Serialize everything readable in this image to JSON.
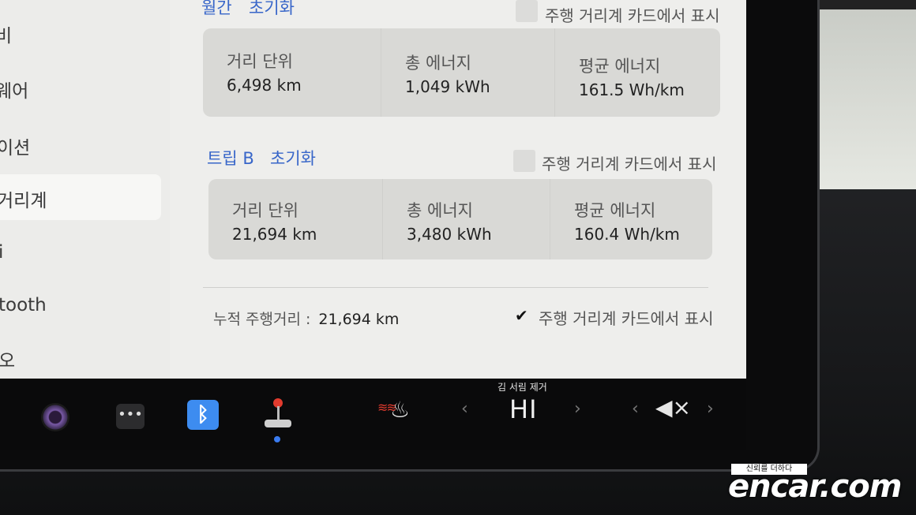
{
  "sidebar": {
    "items": [
      {
        "label": "비"
      },
      {
        "label": "웨어"
      },
      {
        "label": "이션"
      },
      {
        "label": "거리계",
        "active": true
      },
      {
        "label": "i"
      },
      {
        "label": "tooth"
      },
      {
        "label": "오"
      }
    ]
  },
  "trip_a": {
    "title": "월간",
    "reset_label": "초기화",
    "show_on_card_label": "주행 거리계 카드에서 표시",
    "show_on_card_checked": false,
    "stats": [
      {
        "label": "거리 단위",
        "value": "6,498 km"
      },
      {
        "label": "총 에너지",
        "value": "1,049 kWh"
      },
      {
        "label": "평균 에너지",
        "value": "161.5 Wh/km"
      }
    ]
  },
  "trip_b": {
    "title": "트립 B",
    "reset_label": "초기화",
    "show_on_card_label": "주행 거리계 카드에서 표시",
    "show_on_card_checked": false,
    "stats": [
      {
        "label": "거리 단위",
        "value": "21,694 km"
      },
      {
        "label": "총 에너지",
        "value": "3,480 kWh"
      },
      {
        "label": "평균 에너지",
        "value": "160.4 Wh/km"
      }
    ]
  },
  "odometer": {
    "label": "누적 주행거리 :",
    "value": "21,694 km",
    "show_on_card_label": "주행 거리계 카드에서 표시",
    "show_on_card_checked": true,
    "check_glyph": "✔"
  },
  "taskbar": {
    "dots_glyph": "•••",
    "bluetooth_glyph": "ᛒ",
    "heat_glyph": "≋≋",
    "seat_glyph": "♨",
    "chev_left": "‹",
    "chev_right": "›",
    "fan_title": "김 서림 제거",
    "fan_value": "HI",
    "volume_glyph": "◀×",
    "icons": [
      "camera-icon",
      "more-icon",
      "bluetooth-icon",
      "joystick-icon",
      "seat-heater-icon",
      "volume-mute-icon"
    ],
    "bluetooth_color": "#3d8cf0"
  },
  "watermark": {
    "tagline": "신뢰를 더하다",
    "brand": "encar.com"
  }
}
